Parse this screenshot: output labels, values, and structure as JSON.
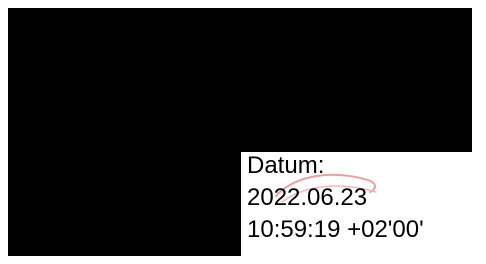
{
  "signature_block": {
    "label": "Datum:",
    "date": "2022.06.23",
    "time": "10:59:19 +02'00'"
  },
  "colors": {
    "redaction": "#000000",
    "background": "#ffffff",
    "text": "#000000",
    "stamp": "#e8a0a0"
  }
}
